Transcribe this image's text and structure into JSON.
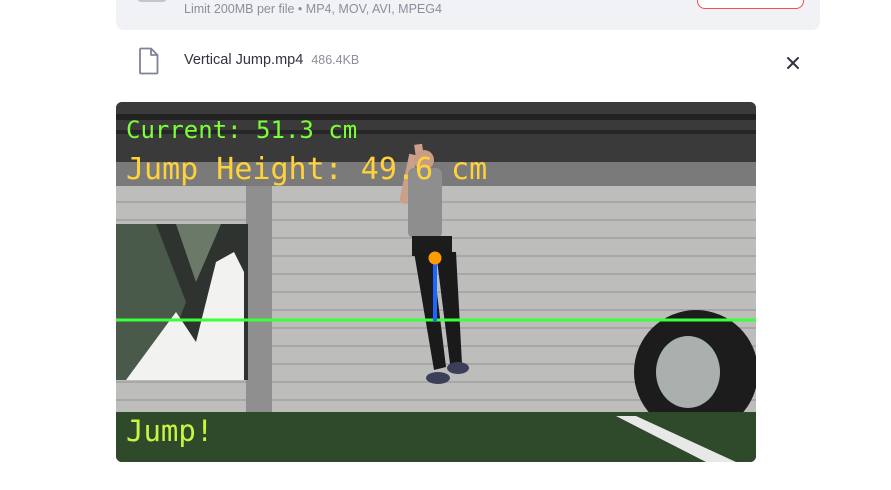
{
  "uploader": {
    "limit_text": "Limit 200MB per file • MP4, MOV, AVI, MPEG4"
  },
  "file": {
    "name": "Vertical Jump.mp4",
    "size": "486.4KB",
    "icon": "file-icon",
    "remove_icon": "close-icon"
  },
  "video": {
    "current_text": "Current: 51.3 cm",
    "jump_height_text": "Jump Height: 49.6 cm",
    "status_text": "Jump!",
    "colors": {
      "current": "#7cff3a",
      "jump_height": "#ffd23a",
      "status": "#c8f542",
      "baseline": "#3cff3c",
      "marker_line": "#1e64ff",
      "marker_dot": "#ff9a00"
    }
  }
}
